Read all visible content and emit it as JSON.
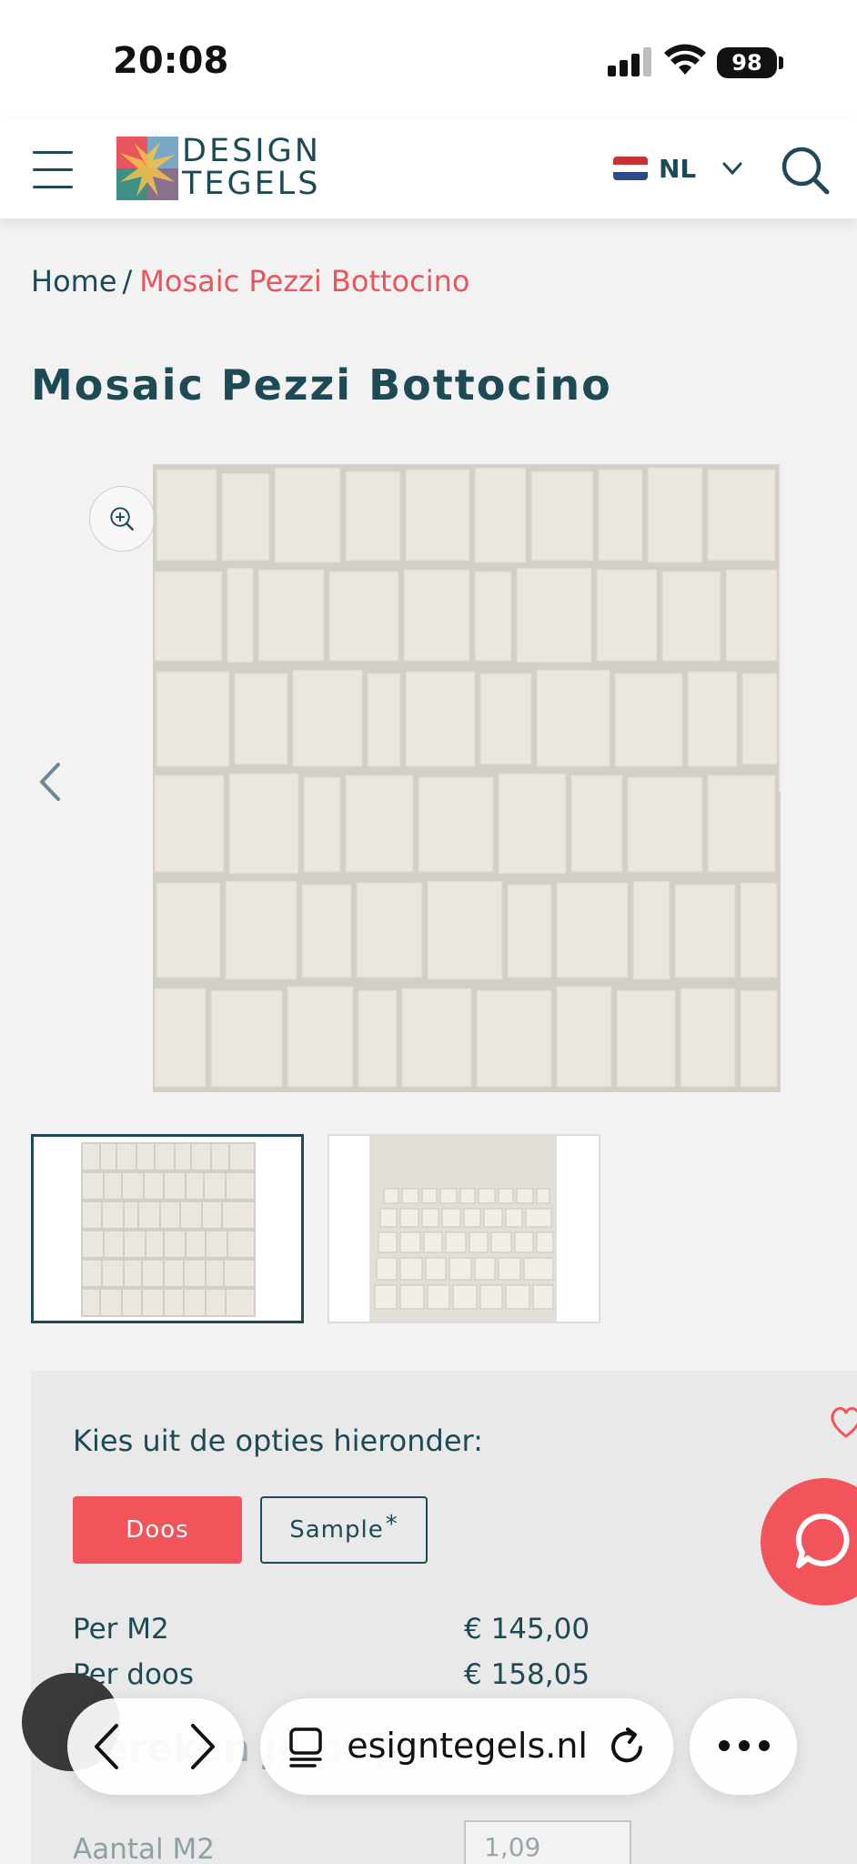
{
  "status_bar": {
    "time": "20:08",
    "battery": "98"
  },
  "header": {
    "logo_line1": "DESIGN",
    "logo_line2": "TEGELS",
    "language": "NL",
    "icons": [
      "menu-icon",
      "logo-icon",
      "flag-nl-icon",
      "chevron-down-icon",
      "search-icon"
    ]
  },
  "breadcrumb": {
    "home": "Home",
    "separator": "/",
    "current": "Mosaic Pezzi Bottocino"
  },
  "product": {
    "title": "Mosaic Pezzi Bottocino",
    "thumbnails": [
      "thumbnail-1",
      "thumbnail-2"
    ]
  },
  "options": {
    "label": "Kies uit de opties hieronder:",
    "buttons": [
      {
        "label": "Doos",
        "selected": true
      },
      {
        "label": "Sample",
        "suffix": "*",
        "selected": false
      }
    ]
  },
  "prices": [
    {
      "label": "Per M2",
      "value": "€ 145,00"
    },
    {
      "label": "Per doos",
      "value": "€ 158,05"
    }
  ],
  "calculator": {
    "title": "Bereken je prijs",
    "qty_label": "Aantal M2",
    "qty_value": "1,09"
  },
  "browser": {
    "url": "designtegels.nl"
  },
  "colors": {
    "brand_teal": "#1d4a55",
    "accent_red": "#f2545b",
    "breadcrumb_red": "#e8555e"
  }
}
